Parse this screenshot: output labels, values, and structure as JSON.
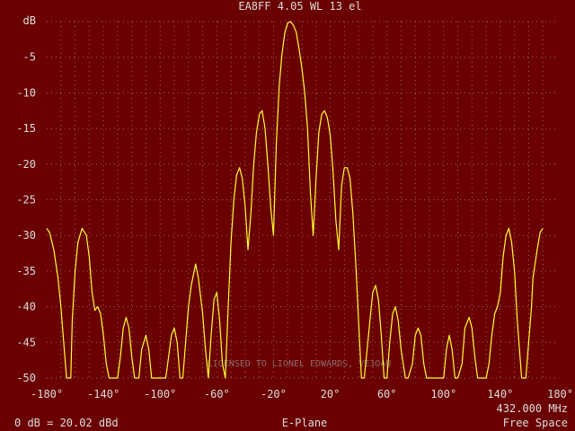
{
  "colors": {
    "background": "#6a0000",
    "text": "#dcdcdc",
    "grid": "#9a6666",
    "trace": "#ffff33"
  },
  "chart_data": {
    "type": "line",
    "title": "EA8FF  4.05 WL 13 el",
    "grid": true,
    "xlim": [
      -180,
      180
    ],
    "ylim": [
      -50,
      0
    ],
    "ylabel": "dB",
    "x_ticks": [
      "-180°",
      "-140°",
      "-100°",
      "-60°",
      "-20°",
      "20°",
      "60°",
      "100°",
      "140°",
      "180°"
    ],
    "x_tick_values": [
      -180,
      -140,
      -100,
      -60,
      -20,
      20,
      60,
      100,
      140,
      180
    ],
    "y_ticks": [
      "-5",
      "-10",
      "-15",
      "-20",
      "-25",
      "-30",
      "-35",
      "-40",
      "-45",
      "-50"
    ],
    "y_tick_values": [
      -5,
      -10,
      -15,
      -20,
      -25,
      -30,
      -35,
      -40,
      -45,
      -50
    ],
    "x": [
      -180,
      -178,
      -175,
      -172,
      -170,
      -168,
      -166,
      -163,
      -162,
      -160,
      -158,
      -155,
      -152,
      -150,
      -148,
      -146,
      -144,
      -142,
      -140,
      -138,
      -136,
      -134,
      -132,
      -130,
      -128,
      -126,
      -124,
      -122,
      -120,
      -118,
      -115,
      -113,
      -110,
      -108,
      -106,
      -104,
      -102,
      -100,
      -98,
      -96,
      -94,
      -92,
      -90,
      -88,
      -86,
      -84,
      -82,
      -80,
      -78,
      -75,
      -73,
      -70,
      -68,
      -66,
      -64,
      -62,
      -60,
      -58,
      -56,
      -54,
      -52,
      -50,
      -48,
      -46,
      -44,
      -42,
      -40,
      -38,
      -36,
      -34,
      -32,
      -30,
      -28,
      -26,
      -24,
      -22,
      -20,
      -18,
      -16,
      -14,
      -12,
      -10,
      -8,
      -6,
      -4,
      -2,
      0,
      2,
      4,
      6,
      8,
      10,
      12,
      14,
      16,
      18,
      20,
      22,
      24,
      26,
      28,
      30,
      32,
      34,
      36,
      38,
      40,
      42,
      44,
      46,
      48,
      50,
      52,
      54,
      56,
      58,
      60,
      62,
      64,
      66,
      68,
      70,
      73,
      75,
      78,
      80,
      82,
      84,
      86,
      88,
      90,
      92,
      94,
      96,
      98,
      100,
      102,
      104,
      106,
      108,
      110,
      113,
      115,
      118,
      120,
      122,
      124,
      126,
      128,
      130,
      132,
      134,
      136,
      138,
      140,
      142,
      144,
      146,
      148,
      150,
      152,
      155,
      158,
      160,
      162,
      163,
      166,
      168,
      170,
      172,
      175,
      178,
      180
    ],
    "series": [
      {
        "values": [
          -29,
          -29.6,
          -32,
          -36,
          -40,
          -45,
          -50,
          -50,
          -42,
          -35,
          -31,
          -29,
          -30,
          -33,
          -38,
          -40.5,
          -40,
          -41,
          -44,
          -48,
          -50,
          -50,
          -50,
          -50,
          -47,
          -43,
          -41.5,
          -43,
          -47,
          -50,
          -50,
          -46,
          -44,
          -46,
          -50,
          -50,
          -50,
          -50,
          -50,
          -50,
          -47,
          -44,
          -43,
          -45,
          -50,
          -50,
          -45,
          -40,
          -37,
          -34,
          -36,
          -41,
          -46,
          -50,
          -44,
          -39,
          -38,
          -42,
          -48,
          -50,
          -40,
          -31,
          -25,
          -21.5,
          -20.5,
          -22,
          -26,
          -32,
          -27,
          -20,
          -15.5,
          -13,
          -12.5,
          -15,
          -20,
          -26,
          -30,
          -17,
          -9,
          -4.5,
          -1.5,
          -0.2,
          0,
          -0.5,
          -1.5,
          -3.8,
          -6.5,
          -10,
          -15,
          -24,
          -30,
          -22,
          -15.5,
          -13,
          -12.5,
          -13.5,
          -16,
          -21,
          -28,
          -32,
          -23,
          -20.5,
          -20.5,
          -22,
          -27,
          -34,
          -42,
          -50,
          -50,
          -46,
          -42,
          -38,
          -37,
          -39,
          -44,
          -50,
          -50,
          -45,
          -41,
          -40,
          -42,
          -46,
          -50,
          -50,
          -48,
          -44,
          -43,
          -44,
          -48,
          -50,
          -50,
          -50,
          -50,
          -50,
          -50,
          -50,
          -46,
          -44,
          -46,
          -50,
          -50,
          -48,
          -43,
          -41.5,
          -43,
          -47,
          -50,
          -50,
          -50,
          -50,
          -48,
          -44,
          -41,
          -40,
          -38,
          -33,
          -30,
          -29,
          -31,
          -35,
          -42,
          -50,
          -50,
          -45,
          -40,
          -36,
          -32,
          -29.6,
          -29
        ]
      }
    ],
    "annotations": {
      "bottom_left": "0 dB = 20.02 dBd",
      "bottom_center": "E-Plane",
      "frequency": "432.000 MHz",
      "bottom_right": "Free Space",
      "watermark": "LICENSED TO LIONEL EDWARDS, VE3OAU"
    }
  }
}
